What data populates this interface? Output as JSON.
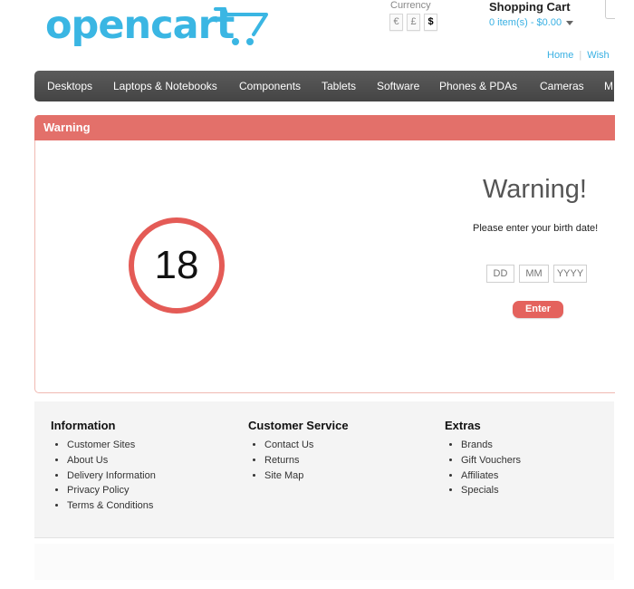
{
  "header": {
    "logo_text": "opencart",
    "currency_label": "Currency",
    "currencies": [
      {
        "symbol": "€",
        "selected": false
      },
      {
        "symbol": "£",
        "selected": false
      },
      {
        "symbol": "$",
        "selected": true
      }
    ],
    "cart_title": "Shopping Cart",
    "cart_total": "0 item(s) - $0.00",
    "links": [
      "Home",
      "Wish"
    ]
  },
  "menu": {
    "items": [
      "Desktops",
      "Laptops & Notebooks",
      "Components",
      "Tablets",
      "Software",
      "Phones & PDAs",
      "Cameras",
      "M"
    ]
  },
  "warning": {
    "header_label": "Warning",
    "age": "18",
    "title": "Warning!",
    "message": "Please enter your birth date!",
    "dd_placeholder": "DD",
    "mm_placeholder": "MM",
    "yyyy_placeholder": "YYYY",
    "enter_label": "Enter"
  },
  "footer": {
    "information": {
      "title": "Information",
      "items": [
        "Customer Sites",
        "About Us",
        "Delivery Information",
        "Privacy Policy",
        "Terms & Conditions"
      ]
    },
    "customer_service": {
      "title": "Customer Service",
      "items": [
        "Contact Us",
        "Returns",
        "Site Map"
      ]
    },
    "extras": {
      "title": "Extras",
      "items": [
        "Brands",
        "Gift Vouchers",
        "Affiliates",
        "Specials"
      ]
    }
  },
  "colors": {
    "brand_blue": "#3ab6e3",
    "warning_red": "#e3706a",
    "menu_gray": "#4f4f4f"
  }
}
